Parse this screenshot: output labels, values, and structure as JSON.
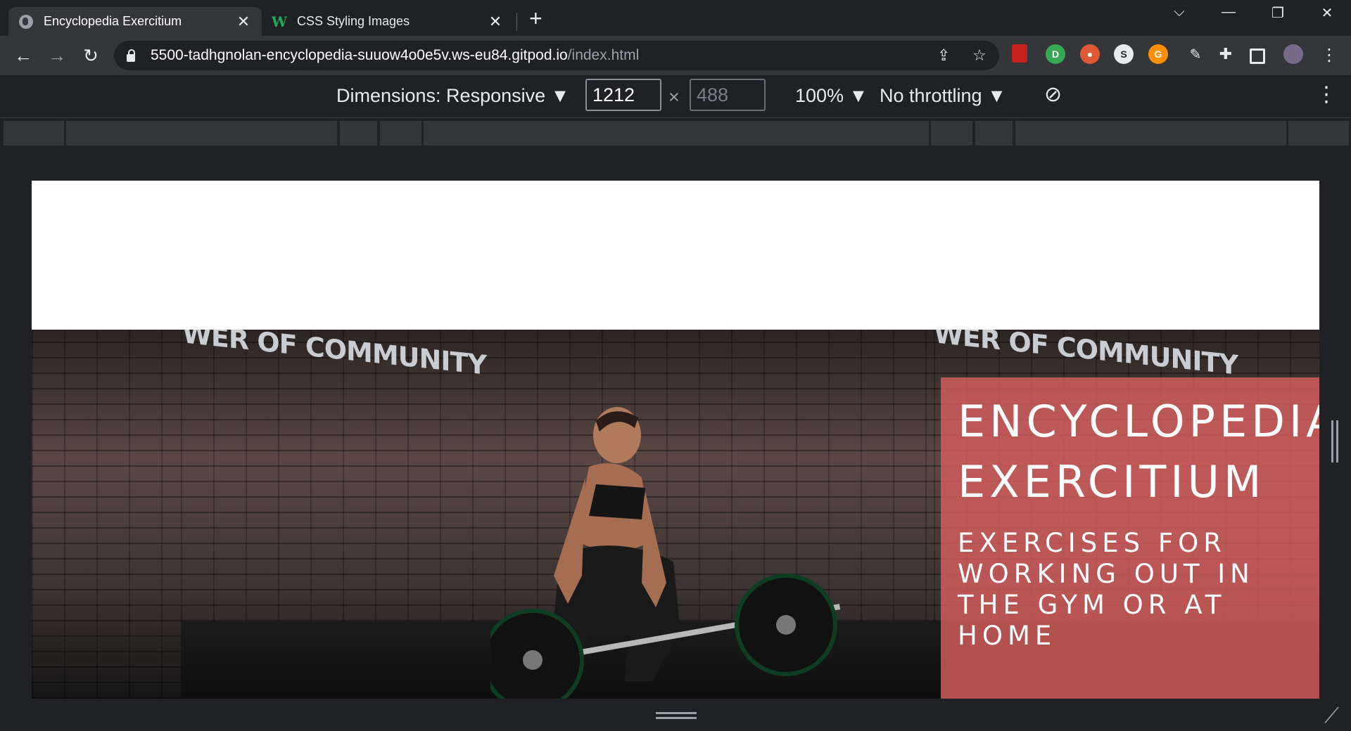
{
  "tabs": [
    {
      "label": "Encyclopedia Exercitium",
      "icon": "globe-icon",
      "active": true
    },
    {
      "label": "CSS Styling Images",
      "icon": "w3schools-icon",
      "active": false
    }
  ],
  "address_bar": {
    "host": "5500-tadhgnolan-encyclopedia-suuow4o0e5v.ws-eu84.gitpod.io",
    "path": "/index.html"
  },
  "device_toolbar": {
    "dimensions_label": "Dimensions: Responsive ▼",
    "width": "1212",
    "separator": "×",
    "height": "488",
    "zoom": "100% ▼",
    "throttling": "No throttling ▼"
  },
  "hero": {
    "wall_text": "WER OF COMMUNITY",
    "title_line1": "ENCYCLOPEDIA",
    "title_line2": "EXERCITIUM",
    "subtitle": "EXERCISES FOR WORKING OUT IN THE GYM OR AT HOME",
    "overlay_color": "#d65e5e"
  },
  "extensions": [
    "bookmark-icon",
    "pushbullet-icon",
    "duckduckgo-icon",
    "sync-icon",
    "grammarly-icon",
    "eyedropper-icon",
    "puzzle-icon",
    "sidepanel-icon",
    "profile-avatar"
  ]
}
